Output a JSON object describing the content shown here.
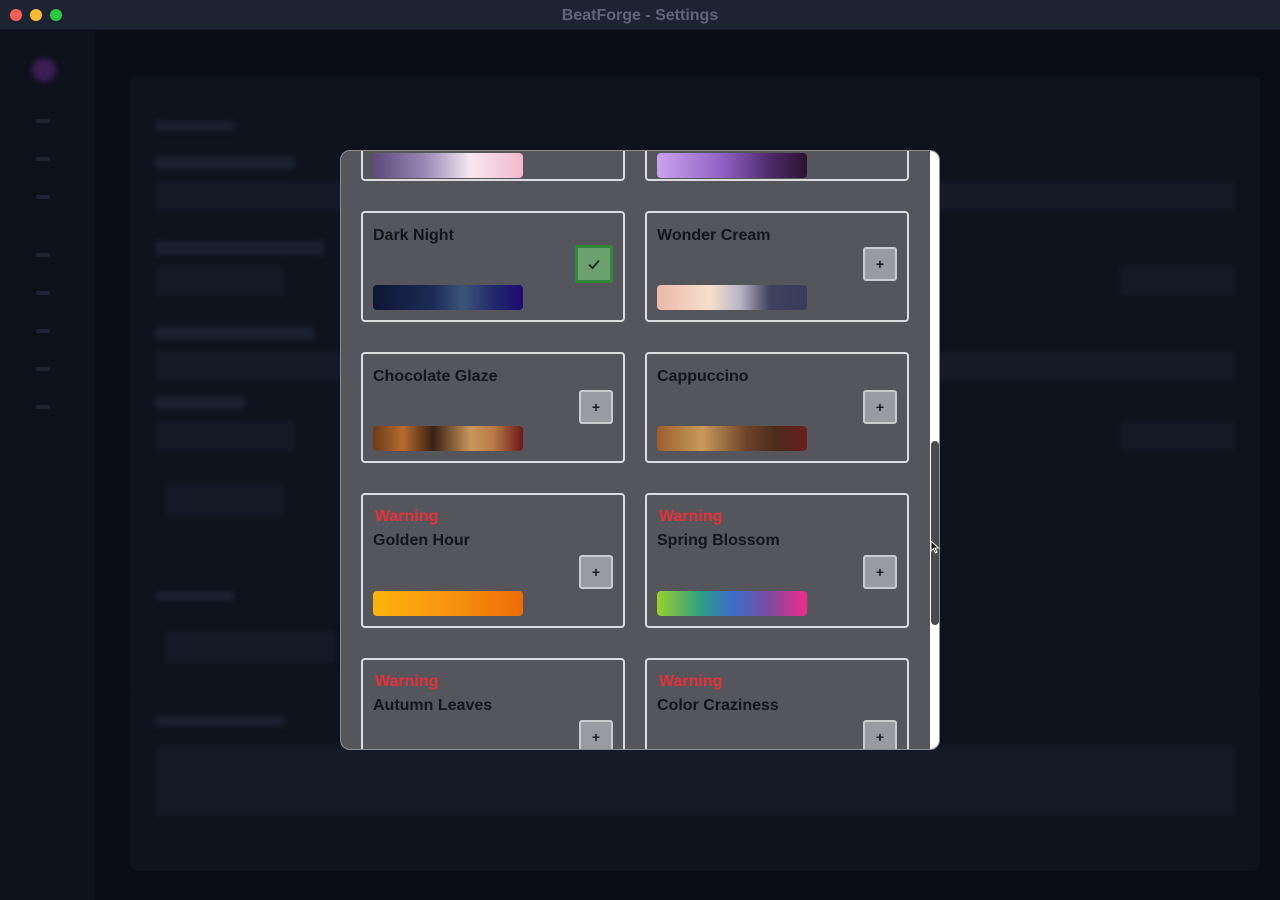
{
  "window": {
    "title": "BeatForge - Settings"
  },
  "modal": {
    "cards": [
      {
        "title": "",
        "warning": "",
        "action": "add",
        "gradient": "linear-gradient(90deg,#5b4a7a 0%,#9b88b5 35%,#f6e8ee 65%,#f1b8cf 100%)"
      },
      {
        "title": "",
        "warning": "",
        "action": "add",
        "gradient": "linear-gradient(90deg,#c9a3ef 0%,#8d5fc1 45%,#4e2a6b 75%,#2a1330 100%)"
      },
      {
        "title": "Dark Night",
        "warning": "",
        "action": "selected",
        "gradient": "linear-gradient(90deg,#0f1633 0%,#1c2b56 40%,#3d5479 60%,#232a6a 80%,#1e0a72 100%)"
      },
      {
        "title": "Wonder Cream",
        "warning": "",
        "action": "add",
        "gradient": "linear-gradient(90deg,#eab8a9 0%,#f7dfcc 35%,#bbb7c6 55%,#40415d 75%,#3a3c5a 100%)"
      },
      {
        "title": "Chocolate Glaze",
        "warning": "",
        "action": "add",
        "gradient": "linear-gradient(90deg,#6d3a1a 0%,#b46c2e 20%,#3a2012 40%,#c8965a 65%,#ba7b46 80%,#6a1a18 100%)"
      },
      {
        "title": "Cappuccino",
        "warning": "",
        "action": "add",
        "gradient": "linear-gradient(90deg,#9a5f2c 0%,#c89a5a 30%,#6b4428 60%,#4b2a1c 80%,#6a1e1e 100%)"
      },
      {
        "title": "Golden Hour",
        "warning": "Warning",
        "action": "add",
        "gradient": "linear-gradient(90deg,#fdb40e 0%,#f89410 50%,#ee6c04 100%)"
      },
      {
        "title": "Spring Blossom",
        "warning": "Warning",
        "action": "add",
        "gradient": "linear-gradient(90deg,#9ccf2a 0%,#2a9e87 30%,#3a6fc8 50%,#7d4aa0 75%,#f02b8a 100%)"
      },
      {
        "title": "Autumn Leaves",
        "warning": "Warning",
        "action": "add",
        "gradient": ""
      },
      {
        "title": "Color Craziness",
        "warning": "Warning",
        "action": "add",
        "gradient": ""
      }
    ],
    "add_label": "+"
  },
  "colors": {
    "modal_bg": "#55565c",
    "warning": "#e8303a",
    "selected_bg": "#6ca26f",
    "selected_border": "#2e8a3a"
  },
  "icons": {
    "selected": "check-icon",
    "add": "plus-icon"
  }
}
